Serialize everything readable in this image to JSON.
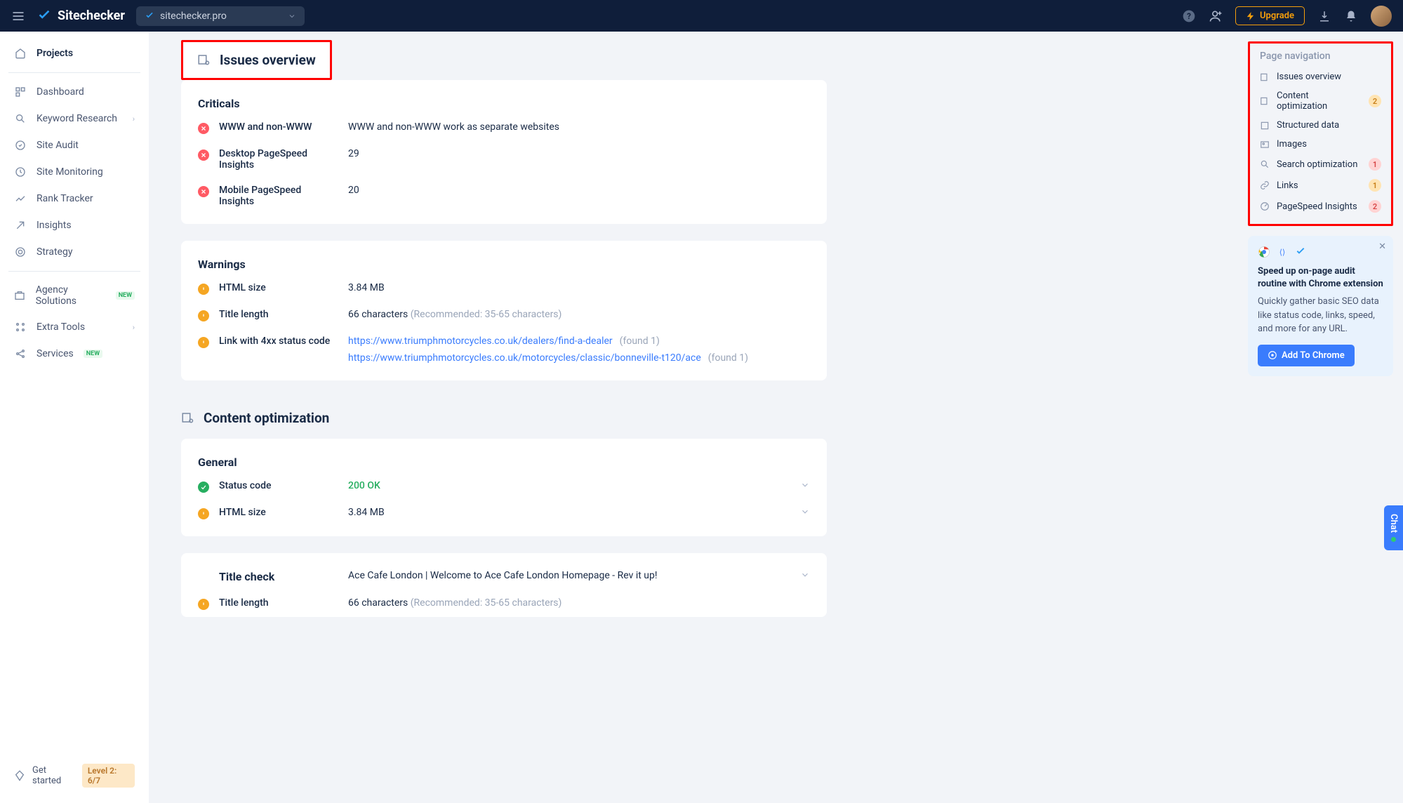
{
  "topbar": {
    "brand": "Sitechecker",
    "site": "sitechecker.pro",
    "upgrade": "Upgrade"
  },
  "sidebar": {
    "projects": "Projects",
    "items": [
      {
        "label": "Dashboard"
      },
      {
        "label": "Keyword Research",
        "chev": true
      },
      {
        "label": "Site Audit"
      },
      {
        "label": "Site Monitoring"
      },
      {
        "label": "Rank Tracker"
      },
      {
        "label": "Insights"
      },
      {
        "label": "Strategy"
      }
    ],
    "items2": [
      {
        "label": "Agency Solutions",
        "new": true
      },
      {
        "label": "Extra Tools",
        "chev": true
      },
      {
        "label": "Services",
        "new": true
      }
    ],
    "footer": {
      "label": "Get started",
      "level": "Level 2: 6/7"
    }
  },
  "main": {
    "issues_overview": "Issues overview",
    "criticals": {
      "title": "Criticals",
      "rows": [
        {
          "label": "WWW and non-WWW",
          "value": "WWW and non-WWW work as separate websites"
        },
        {
          "label": "Desktop PageSpeed Insights",
          "value": "29"
        },
        {
          "label": "Mobile PageSpeed Insights",
          "value": "20"
        }
      ]
    },
    "warnings": {
      "title": "Warnings",
      "rows": [
        {
          "label": "HTML size",
          "value": "3.84 MB"
        },
        {
          "label": "Title length",
          "value": "66 characters ",
          "hint": "(Recommended: 35-65 characters)"
        }
      ],
      "links_row": {
        "label": "Link with 4xx status code",
        "links": [
          {
            "url": "https://www.triumphmotorcycles.co.uk/dealers/find-a-dealer",
            "found": "(found 1)"
          },
          {
            "url": "https://www.triumphmotorcycles.co.uk/motorcycles/classic/bonneville-t120/ace",
            "found": "(found 1)"
          }
        ]
      }
    },
    "content_opt": {
      "title": "Content optimization",
      "general": "General",
      "rows": [
        {
          "status": "ok",
          "label": "Status code",
          "value": "200 OK",
          "green": true,
          "exp": true
        },
        {
          "status": "warn",
          "label": "HTML size",
          "value": "3.84 MB",
          "exp": true
        }
      ],
      "title_check": {
        "title": "Title check",
        "value": "Ace Cafe London | Welcome to Ace Cafe London Homepage - Rev it up!",
        "row": {
          "label": "Title length",
          "value": "66 characters ",
          "hint": "(Recommended: 35-65 characters)"
        }
      }
    }
  },
  "nav": {
    "title": "Page navigation",
    "items": [
      {
        "label": "Issues overview"
      },
      {
        "label": "Content optimization",
        "count": "2",
        "cls": "orange"
      },
      {
        "label": "Structured data"
      },
      {
        "label": "Images"
      },
      {
        "label": "Search optimization",
        "count": "1",
        "cls": "red"
      },
      {
        "label": "Links",
        "count": "1",
        "cls": "orange"
      },
      {
        "label": "PageSpeed Insights",
        "count": "2",
        "cls": "red"
      }
    ]
  },
  "promo": {
    "title": "Speed up on-page audit routine with Chrome extension",
    "desc": "Quickly gather basic SEO data like status code, links, speed, and more for any URL.",
    "btn": "Add To Chrome"
  },
  "chat": "Chat"
}
